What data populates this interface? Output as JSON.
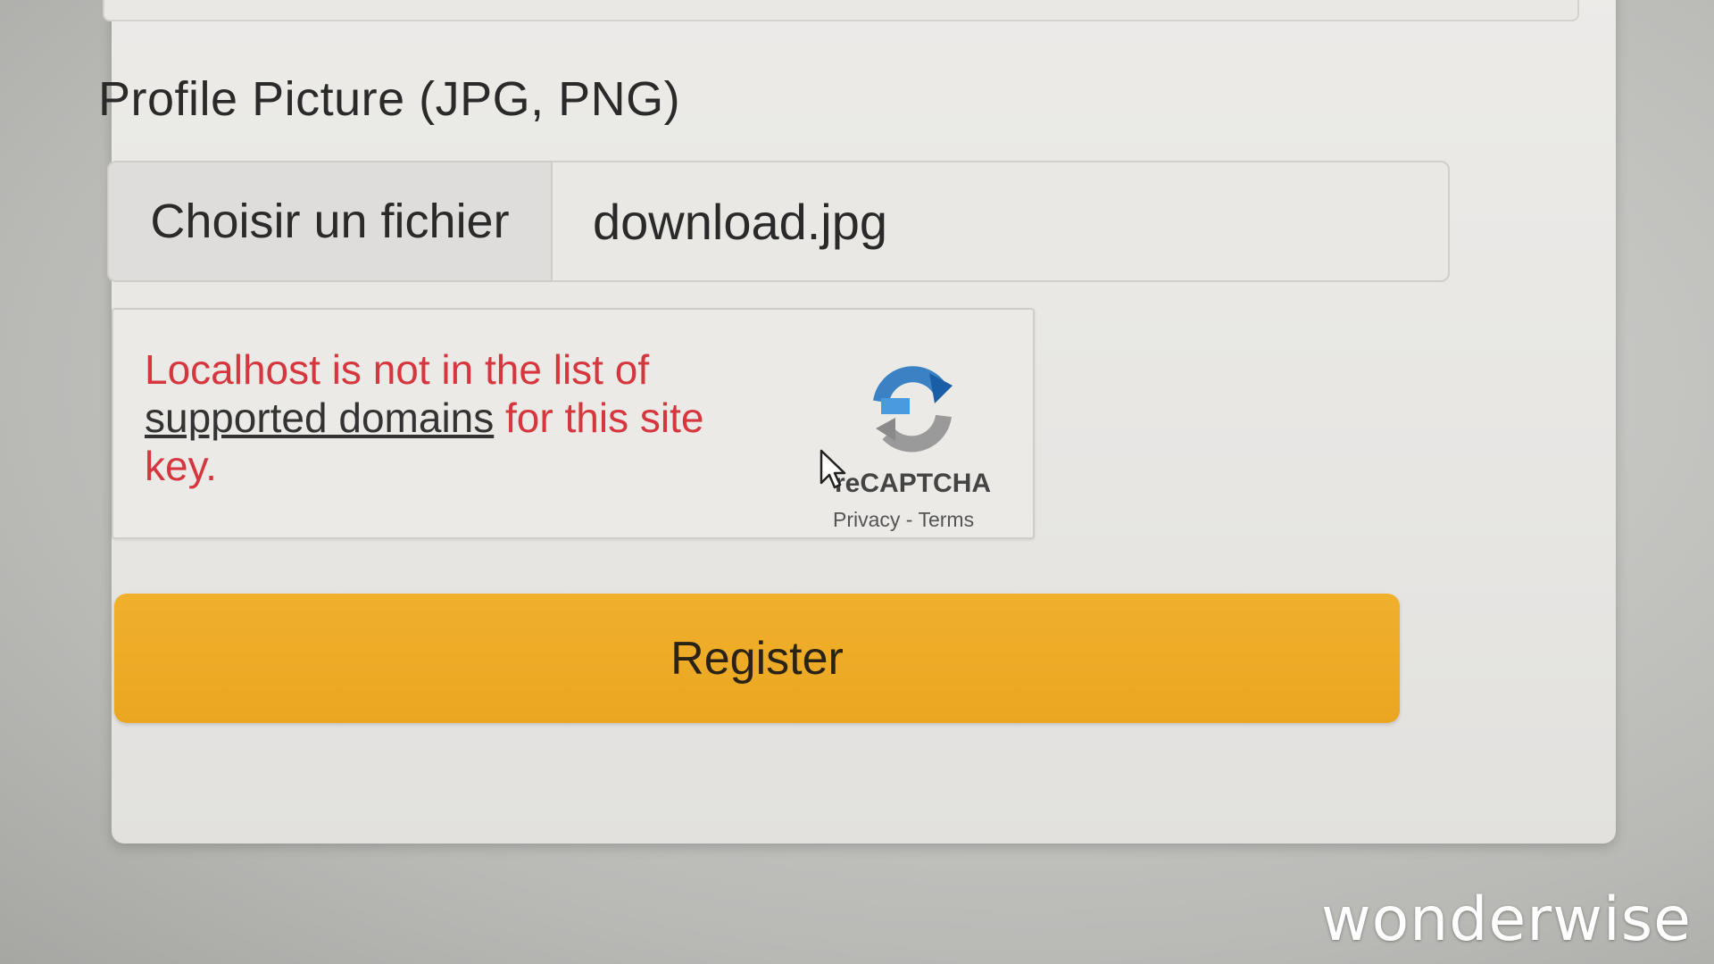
{
  "form": {
    "profile_picture_label": "Profile Picture (JPG, PNG)",
    "file_choose_label": "Choisir un fichier",
    "file_name": "download.jpg",
    "register_label": "Register"
  },
  "captcha": {
    "error_prefix": "Localhost is not in the list of",
    "error_link": "supported domains",
    "error_suffix": "for this site key.",
    "brand": "reCAPTCHA",
    "privacy_label": "Privacy",
    "separator": "-",
    "terms_label": "Terms"
  },
  "watermark": {
    "text": "wonderwise"
  },
  "colors": {
    "accent": "#EBA621",
    "error": "#D6373E"
  },
  "icons": {
    "recaptcha": "recaptcha-logo-icon",
    "cursor": "mouse-pointer-icon"
  }
}
